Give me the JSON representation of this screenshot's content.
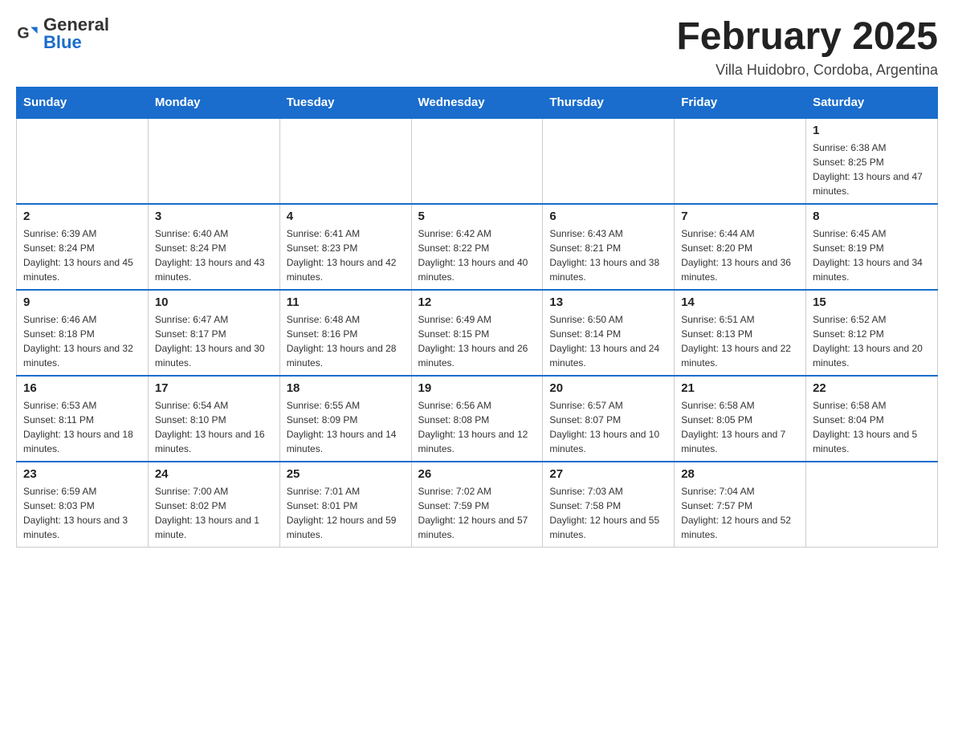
{
  "header": {
    "logo_general": "General",
    "logo_blue": "Blue",
    "month_title": "February 2025",
    "location": "Villa Huidobro, Cordoba, Argentina"
  },
  "days_of_week": [
    "Sunday",
    "Monday",
    "Tuesday",
    "Wednesday",
    "Thursday",
    "Friday",
    "Saturday"
  ],
  "weeks": [
    [
      {
        "day": "",
        "info": ""
      },
      {
        "day": "",
        "info": ""
      },
      {
        "day": "",
        "info": ""
      },
      {
        "day": "",
        "info": ""
      },
      {
        "day": "",
        "info": ""
      },
      {
        "day": "",
        "info": ""
      },
      {
        "day": "1",
        "info": "Sunrise: 6:38 AM\nSunset: 8:25 PM\nDaylight: 13 hours and 47 minutes."
      }
    ],
    [
      {
        "day": "2",
        "info": "Sunrise: 6:39 AM\nSunset: 8:24 PM\nDaylight: 13 hours and 45 minutes."
      },
      {
        "day": "3",
        "info": "Sunrise: 6:40 AM\nSunset: 8:24 PM\nDaylight: 13 hours and 43 minutes."
      },
      {
        "day": "4",
        "info": "Sunrise: 6:41 AM\nSunset: 8:23 PM\nDaylight: 13 hours and 42 minutes."
      },
      {
        "day": "5",
        "info": "Sunrise: 6:42 AM\nSunset: 8:22 PM\nDaylight: 13 hours and 40 minutes."
      },
      {
        "day": "6",
        "info": "Sunrise: 6:43 AM\nSunset: 8:21 PM\nDaylight: 13 hours and 38 minutes."
      },
      {
        "day": "7",
        "info": "Sunrise: 6:44 AM\nSunset: 8:20 PM\nDaylight: 13 hours and 36 minutes."
      },
      {
        "day": "8",
        "info": "Sunrise: 6:45 AM\nSunset: 8:19 PM\nDaylight: 13 hours and 34 minutes."
      }
    ],
    [
      {
        "day": "9",
        "info": "Sunrise: 6:46 AM\nSunset: 8:18 PM\nDaylight: 13 hours and 32 minutes."
      },
      {
        "day": "10",
        "info": "Sunrise: 6:47 AM\nSunset: 8:17 PM\nDaylight: 13 hours and 30 minutes."
      },
      {
        "day": "11",
        "info": "Sunrise: 6:48 AM\nSunset: 8:16 PM\nDaylight: 13 hours and 28 minutes."
      },
      {
        "day": "12",
        "info": "Sunrise: 6:49 AM\nSunset: 8:15 PM\nDaylight: 13 hours and 26 minutes."
      },
      {
        "day": "13",
        "info": "Sunrise: 6:50 AM\nSunset: 8:14 PM\nDaylight: 13 hours and 24 minutes."
      },
      {
        "day": "14",
        "info": "Sunrise: 6:51 AM\nSunset: 8:13 PM\nDaylight: 13 hours and 22 minutes."
      },
      {
        "day": "15",
        "info": "Sunrise: 6:52 AM\nSunset: 8:12 PM\nDaylight: 13 hours and 20 minutes."
      }
    ],
    [
      {
        "day": "16",
        "info": "Sunrise: 6:53 AM\nSunset: 8:11 PM\nDaylight: 13 hours and 18 minutes."
      },
      {
        "day": "17",
        "info": "Sunrise: 6:54 AM\nSunset: 8:10 PM\nDaylight: 13 hours and 16 minutes."
      },
      {
        "day": "18",
        "info": "Sunrise: 6:55 AM\nSunset: 8:09 PM\nDaylight: 13 hours and 14 minutes."
      },
      {
        "day": "19",
        "info": "Sunrise: 6:56 AM\nSunset: 8:08 PM\nDaylight: 13 hours and 12 minutes."
      },
      {
        "day": "20",
        "info": "Sunrise: 6:57 AM\nSunset: 8:07 PM\nDaylight: 13 hours and 10 minutes."
      },
      {
        "day": "21",
        "info": "Sunrise: 6:58 AM\nSunset: 8:05 PM\nDaylight: 13 hours and 7 minutes."
      },
      {
        "day": "22",
        "info": "Sunrise: 6:58 AM\nSunset: 8:04 PM\nDaylight: 13 hours and 5 minutes."
      }
    ],
    [
      {
        "day": "23",
        "info": "Sunrise: 6:59 AM\nSunset: 8:03 PM\nDaylight: 13 hours and 3 minutes."
      },
      {
        "day": "24",
        "info": "Sunrise: 7:00 AM\nSunset: 8:02 PM\nDaylight: 13 hours and 1 minute."
      },
      {
        "day": "25",
        "info": "Sunrise: 7:01 AM\nSunset: 8:01 PM\nDaylight: 12 hours and 59 minutes."
      },
      {
        "day": "26",
        "info": "Sunrise: 7:02 AM\nSunset: 7:59 PM\nDaylight: 12 hours and 57 minutes."
      },
      {
        "day": "27",
        "info": "Sunrise: 7:03 AM\nSunset: 7:58 PM\nDaylight: 12 hours and 55 minutes."
      },
      {
        "day": "28",
        "info": "Sunrise: 7:04 AM\nSunset: 7:57 PM\nDaylight: 12 hours and 52 minutes."
      },
      {
        "day": "",
        "info": ""
      }
    ]
  ]
}
